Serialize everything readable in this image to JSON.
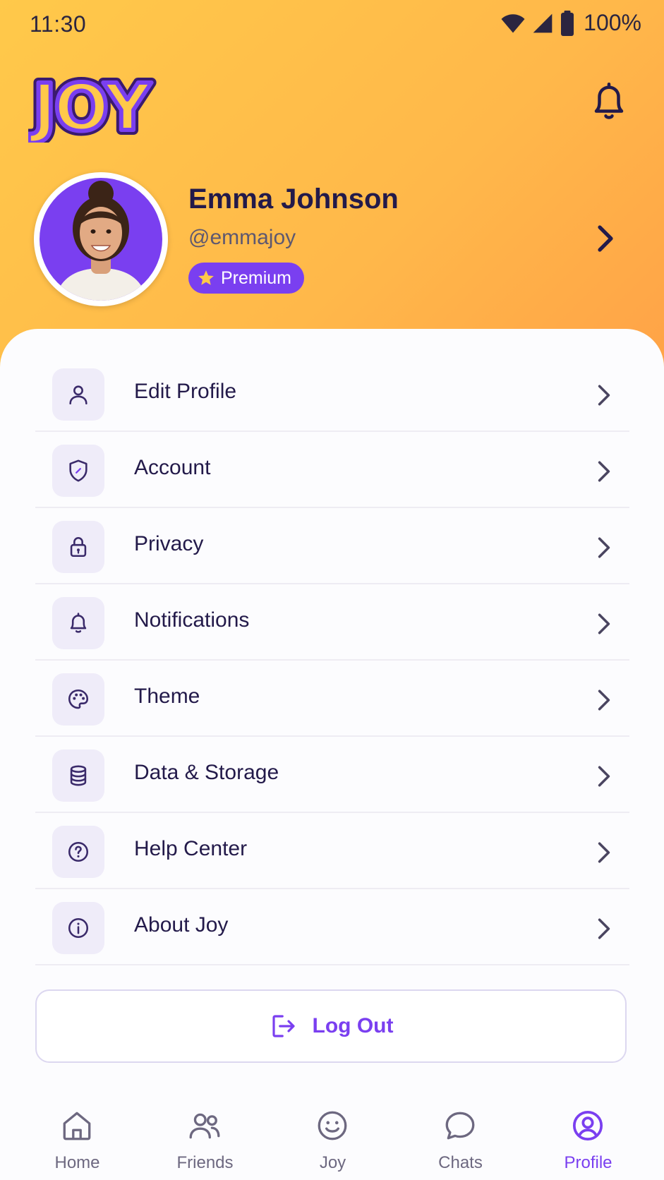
{
  "status_bar": {
    "time": "11:30",
    "battery": "100%"
  },
  "header": {
    "logo_text": "JOY"
  },
  "profile": {
    "name": "Emma Johnson",
    "handle": "@emmajoy",
    "badge": "Premium"
  },
  "menu": {
    "items": [
      {
        "label": "Edit Profile",
        "icon": "user-icon"
      },
      {
        "label": "Account",
        "icon": "shield-icon"
      },
      {
        "label": "Privacy",
        "icon": "lock-icon"
      },
      {
        "label": "Notifications",
        "icon": "bell-icon"
      },
      {
        "label": "Theme",
        "icon": "palette-icon"
      },
      {
        "label": "Data & Storage",
        "icon": "database-icon"
      },
      {
        "label": "Help Center",
        "icon": "help-circle-icon"
      },
      {
        "label": "About Joy",
        "icon": "info-circle-icon"
      }
    ]
  },
  "logout": {
    "label": "Log Out"
  },
  "nav": {
    "items": [
      {
        "label": "Home",
        "icon": "home-icon"
      },
      {
        "label": "Friends",
        "icon": "friends-icon"
      },
      {
        "label": "Joy",
        "icon": "smiley-icon"
      },
      {
        "label": "Chats",
        "icon": "chat-bubble-icon"
      },
      {
        "label": "Profile",
        "icon": "profile-circle-icon",
        "active": true
      }
    ]
  },
  "colors": {
    "accent": "#7a3ff0",
    "header_gradient_start": "#ffc94a",
    "header_gradient_end": "#ffa347",
    "text_primary": "#231a4a",
    "icon_bg": "#efecf9"
  }
}
